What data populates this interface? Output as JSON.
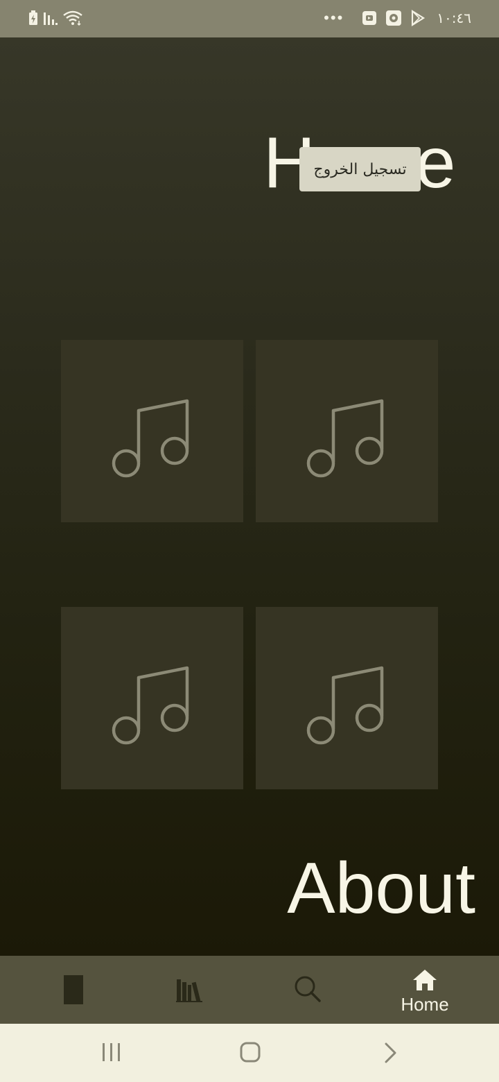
{
  "status_bar": {
    "time": "١٠:٤٦",
    "overflow_dots": "•••",
    "left_icons": [
      "battery-charging-icon",
      "signal-bars-icon",
      "wifi-icon"
    ],
    "right_icons": [
      "download-icon",
      "app-notification-icon",
      "play-store-icon"
    ]
  },
  "main": {
    "home_title": "Home",
    "tooltip": "تسجيل الخروج",
    "about_title": "About",
    "tiles": [
      {
        "icon": "music-note-icon"
      },
      {
        "icon": "music-note-icon"
      },
      {
        "icon": "music-note-icon"
      },
      {
        "icon": "music-note-icon"
      }
    ]
  },
  "bottom_nav": {
    "items": [
      {
        "icon": "rectangle-icon"
      },
      {
        "icon": "library-icon"
      },
      {
        "icon": "search-icon"
      },
      {
        "icon": "home-icon",
        "label": "Home"
      }
    ]
  },
  "system_nav": {
    "buttons": [
      "recents-icon",
      "home-button-icon",
      "back-icon"
    ]
  },
  "colors": {
    "status_bar_bg": "#86846f",
    "tile_bg": "#363423",
    "bottom_nav_bg": "#55533e",
    "system_nav_bg": "#f2f0df",
    "tooltip_bg": "#d8d6c5",
    "title_color": "#f7f5e6"
  }
}
